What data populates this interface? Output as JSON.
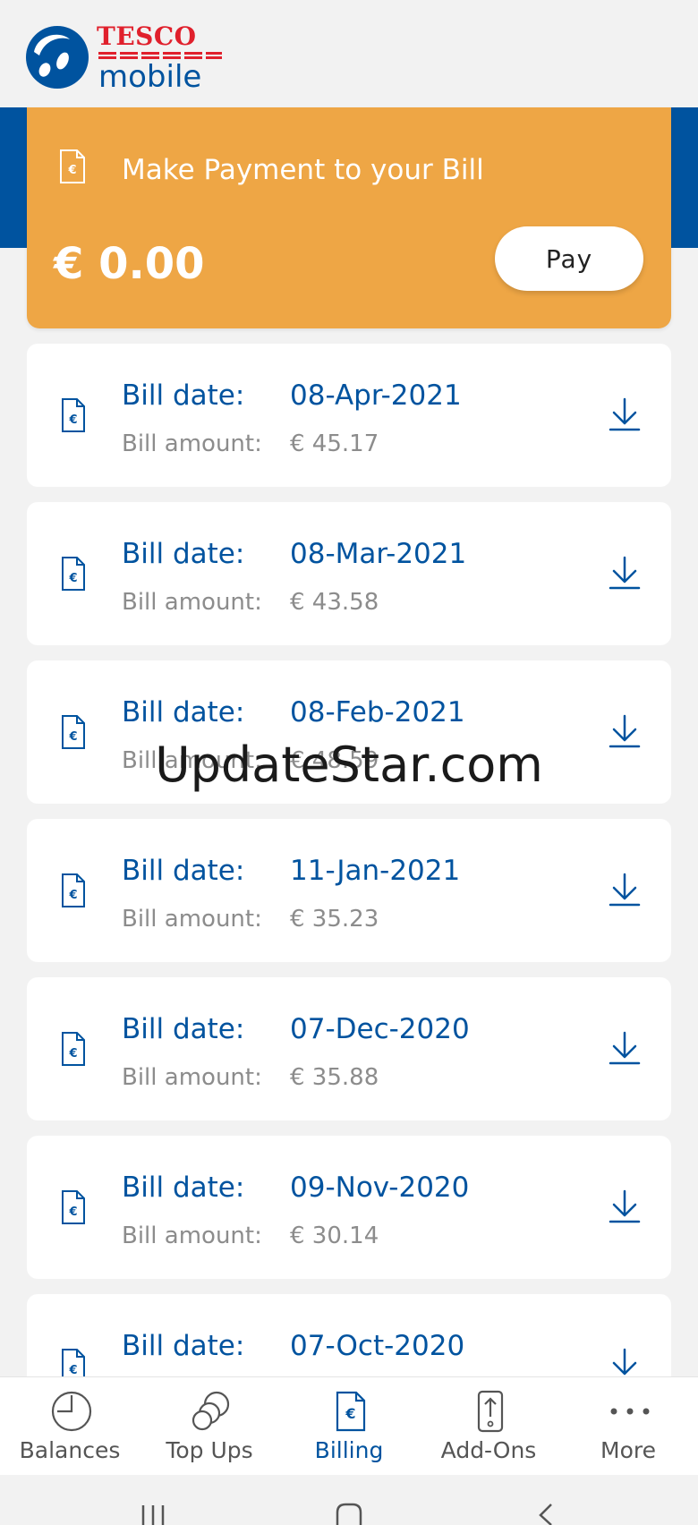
{
  "brand": {
    "tesco": "TESCO",
    "mobile": "mobile",
    "red": "#e0202c",
    "blue": "#00539f"
  },
  "payment": {
    "title": "Make Payment to your Bill",
    "amount": "€ 0.00",
    "pay_label": "Pay",
    "card_color": "#eea645"
  },
  "bills": [
    {
      "date_label": "Bill date:",
      "date": "08-Apr-2021",
      "amount_label": "Bill amount:",
      "amount": "€ 45.17"
    },
    {
      "date_label": "Bill date:",
      "date": "08-Mar-2021",
      "amount_label": "Bill amount:",
      "amount": "€ 43.58"
    },
    {
      "date_label": "Bill date:",
      "date": "08-Feb-2021",
      "amount_label": "Bill amount:",
      "amount": "€ 48.59"
    },
    {
      "date_label": "Bill date:",
      "date": "11-Jan-2021",
      "amount_label": "Bill amount:",
      "amount": "€ 35.23"
    },
    {
      "date_label": "Bill date:",
      "date": "07-Dec-2020",
      "amount_label": "Bill amount:",
      "amount": "€ 35.88"
    },
    {
      "date_label": "Bill date:",
      "date": "09-Nov-2020",
      "amount_label": "Bill amount:",
      "amount": "€ 30.14"
    },
    {
      "date_label": "Bill date:",
      "date": "07-Oct-2020",
      "amount_label": "Bill amount:",
      "amount": ""
    }
  ],
  "watermark": "UpdateStar.com",
  "nav": {
    "items": [
      {
        "label": "Balances",
        "icon": "clock-icon"
      },
      {
        "label": "Top Ups",
        "icon": "coins-icon"
      },
      {
        "label": "Billing",
        "icon": "bill-icon",
        "active": true
      },
      {
        "label": "Add-Ons",
        "icon": "phone-addon-icon"
      },
      {
        "label": "More",
        "icon": "more-dots-icon"
      }
    ]
  }
}
